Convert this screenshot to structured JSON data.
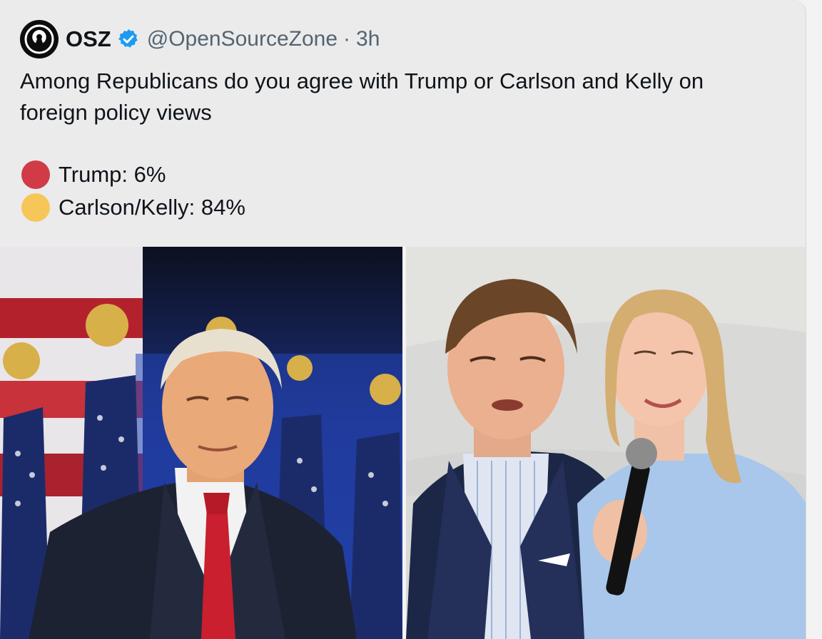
{
  "tweet": {
    "author_name": "OSZ",
    "handle": "@OpenSourceZone",
    "separator": "·",
    "time": "3h",
    "text": "Among Republicans do you agree with Trump or Carlson and Kelly on foreign policy views",
    "poll": [
      {
        "label": "Trump: 6%",
        "color": "#d03b46"
      },
      {
        "label": "Carlson/Kelly: 84%",
        "color": "#f6c659"
      }
    ]
  },
  "colors": {
    "verified": "#1d9bf0",
    "text": "#0f1419",
    "muted": "#536471"
  }
}
